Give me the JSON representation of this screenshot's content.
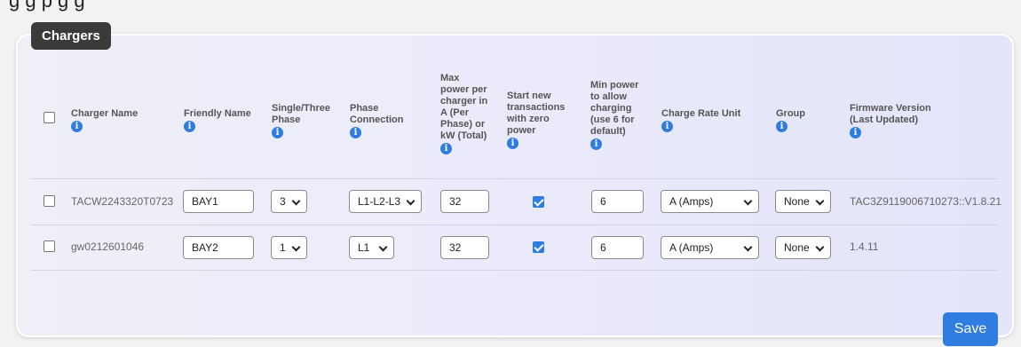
{
  "page_heading_fragment": "g          g p g         g",
  "panel": {
    "title": "Chargers"
  },
  "columns": {
    "name": "Charger Name",
    "friendly": "Friendly Name",
    "phase": [
      "Single/Three",
      "Phase"
    ],
    "connection": [
      "Phase",
      "Connection"
    ],
    "maxpower": [
      "Max",
      "power per",
      "charger in",
      "A (Per",
      "Phase) or",
      "kW (Total)"
    ],
    "zero": [
      "Start new",
      "transactions",
      "with zero",
      "power"
    ],
    "minpower": [
      "Min power",
      "to allow",
      "charging",
      "(use 6 for",
      "default)"
    ],
    "rateunit": "Charge Rate Unit",
    "group": "Group",
    "firmware": [
      "Firmware Version",
      "(Last Updated)"
    ]
  },
  "info_icon": "info-icon",
  "rows": [
    {
      "name": "TACW2243320T0723",
      "friendly": "BAY1",
      "phase": "3",
      "connection": "L1-L2-L3",
      "maxpower": "32",
      "zero_power": true,
      "minpower": "6",
      "rateunit": "A (Amps)",
      "group": "None",
      "firmware": "TAC3Z9119006710273::V1.8.21",
      "selected": false
    },
    {
      "name": "gw0212601046",
      "friendly": "BAY2",
      "phase": "1",
      "connection": "L1",
      "maxpower": "32",
      "zero_power": true,
      "minpower": "6",
      "rateunit": "A (Amps)",
      "group": "None",
      "firmware": "1.4.11",
      "selected": false
    }
  ],
  "save_label": "Save",
  "colors": {
    "accent": "#2f7de1",
    "title_bg": "#3a3a3a"
  }
}
